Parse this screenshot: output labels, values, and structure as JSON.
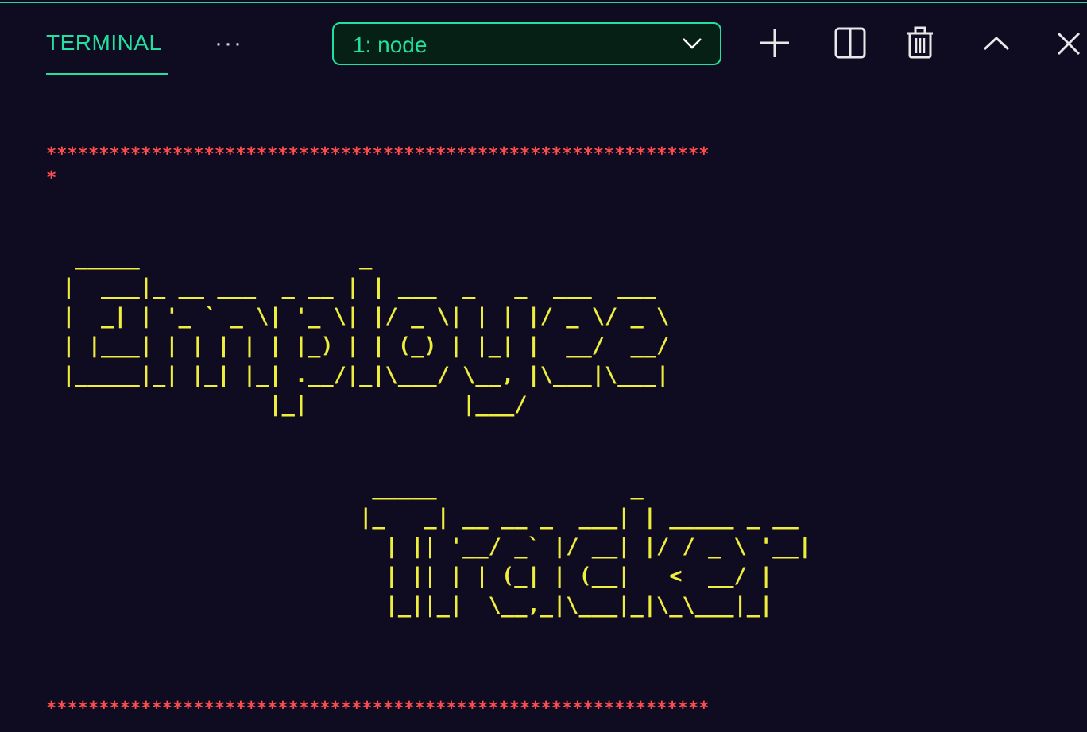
{
  "panel": {
    "tab_label": "TERMINAL",
    "more_label": "···",
    "terminal_select": "1: node"
  },
  "icons": {
    "dropdown": "chevron-down-icon",
    "new_terminal": "plus-icon",
    "split": "split-icon",
    "kill": "trash-icon",
    "maximize": "chevron-up-icon",
    "close": "close-icon"
  },
  "colors": {
    "background": "#0f0c22",
    "accent": "#22e0a0",
    "stars": "#ff4d4d",
    "art": "#f0ee3c"
  },
  "terminal": {
    "stars_top": "***************************************************************",
    "stars_wrap": "*",
    "art_employee": "  _____                 _                       \n |  ___|_ __ ___  _ __ | | ___  _   _  ___  ___ \n |  _| | '_ ` _ \\| '_ \\| |/ _ \\| | | |/ _ \\/ _ \\\n | |___| | | | | | |_) | | (_) | |_| |  __/  __/\n |_____|_| |_| |_| .__/|_|\\___/ \\__, |\\___|\\___|\n                 |_|            |___/            ",
    "art_tracker": "                         _____               _             \n                        |_   _| __ __ _  ___| | _____ _ __ \n                          | || '__/ _` |/ __| |/ / _ \\ '__|\n                          | || | | (_| | (__|   <  __/ |   \n                          |_||_|  \\__,_|\\___|_|\\_\\___|_|   ",
    "stars_bottom": "***************************************************************"
  }
}
